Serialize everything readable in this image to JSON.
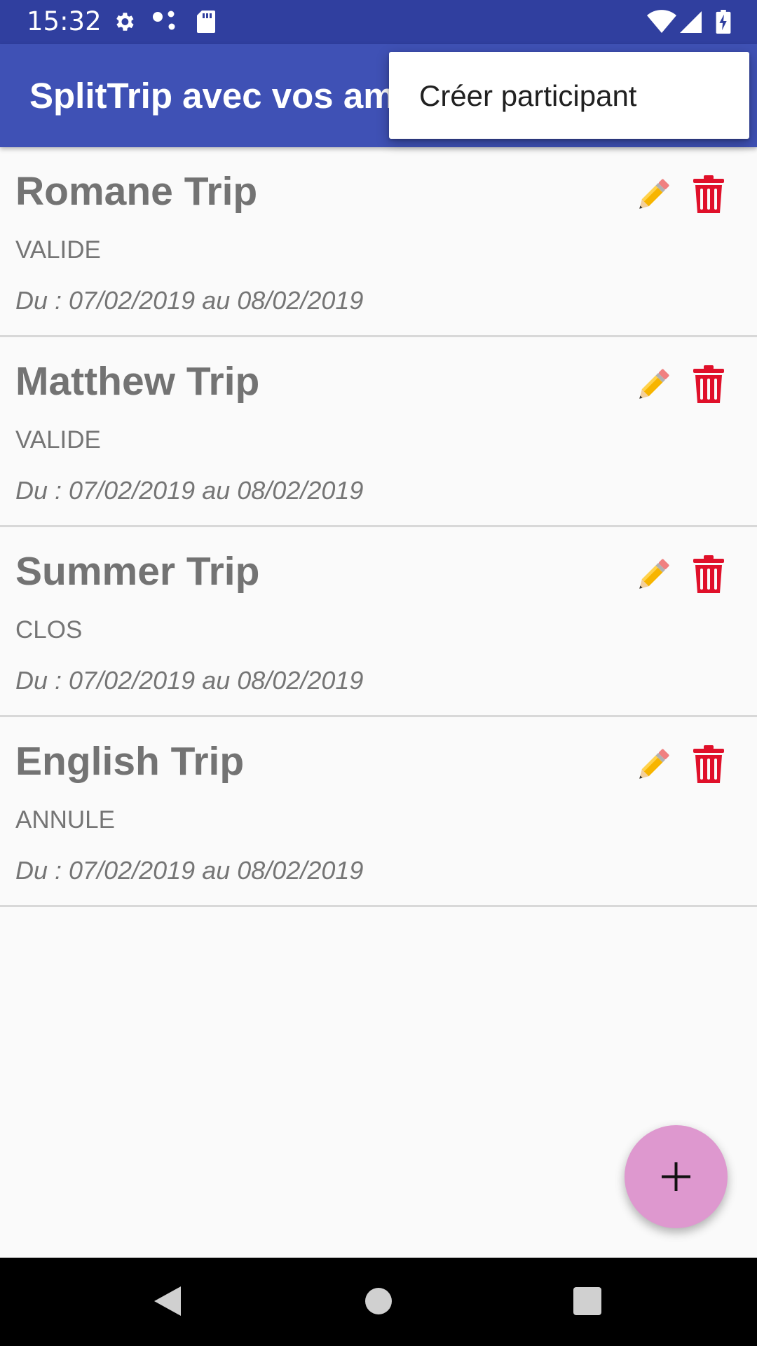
{
  "status_bar": {
    "time": "15:32",
    "icons": [
      "gear-icon",
      "link-icon",
      "sd-card-icon",
      "wifi-icon",
      "signal-icon",
      "battery-charging-icon"
    ]
  },
  "app_bar": {
    "title": "SplitTrip avec vos amis"
  },
  "overflow_menu": {
    "items": [
      {
        "label": "Créer participant"
      }
    ]
  },
  "trips": [
    {
      "name": "Romane Trip",
      "status": "VALIDE",
      "dates": "Du : 07/02/2019 au 08/02/2019"
    },
    {
      "name": "Matthew Trip",
      "status": "VALIDE",
      "dates": "Du : 07/02/2019 au 08/02/2019"
    },
    {
      "name": "Summer Trip",
      "status": "CLOS",
      "dates": "Du : 07/02/2019 au 08/02/2019"
    },
    {
      "name": "English Trip",
      "status": "ANNULE",
      "dates": "Du : 07/02/2019 au 08/02/2019"
    }
  ],
  "item_icons": {
    "edit": "pencil-icon",
    "delete": "trash-icon"
  },
  "fab": {
    "icon": "plus-icon"
  },
  "nav_bar": {
    "icons": [
      "back-icon",
      "home-icon",
      "recents-icon"
    ]
  },
  "colors": {
    "status_bar": "#303f9f",
    "app_bar": "#3f51b5",
    "fab": "#de98cf",
    "delete": "#e0102a",
    "pencil": "#f7b500"
  }
}
